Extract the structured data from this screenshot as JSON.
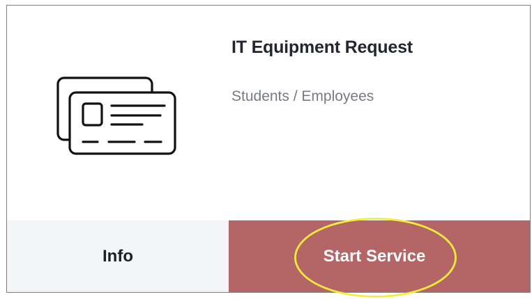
{
  "card": {
    "title": "IT Equipment Request",
    "subtitle": "Students / Employees",
    "icon": "id-card-icon"
  },
  "actions": {
    "info_label": "Info",
    "start_label": "Start Service"
  },
  "colors": {
    "title": "#24262f",
    "subtitle": "#767a83",
    "info_background": "#f4f5f8",
    "start_background": "#b46566",
    "highlight_annotation": "#f5ec3b"
  }
}
